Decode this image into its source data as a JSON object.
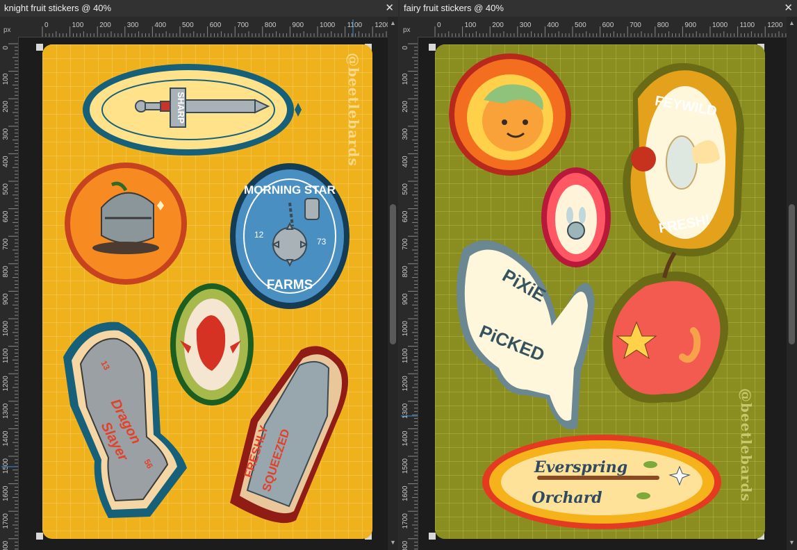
{
  "ruler": {
    "unit": "px",
    "h_ticks": [
      "0",
      "100",
      "200",
      "300",
      "400",
      "500",
      "600",
      "700",
      "800",
      "900",
      "1000",
      "1100",
      "1200"
    ],
    "v_ticks": [
      "0",
      "100",
      "200",
      "300",
      "400",
      "500",
      "600",
      "700",
      "800",
      "900",
      "1000",
      "1100",
      "1200",
      "1300",
      "1400",
      "1500",
      "1600",
      "1700",
      "1800"
    ]
  },
  "left_doc": {
    "tab_title": "knight fruit stickers @ 40%",
    "close_glyph": "✕",
    "bg_color": "#f0b21c",
    "watermark": "@beetlebards",
    "stickers": {
      "sword_label": "SHARP",
      "morning_top": "MORNING STAR",
      "morning_bottom": "FARMS",
      "morning_left_num": "12",
      "morning_right_num": "73",
      "glove_text_1": "Dragon",
      "glove_text_2": "Slayer",
      "glove_num_1": "13",
      "glove_num_2": "56",
      "coffin_text_1": "FRESHLY",
      "coffin_text_2": "SQUEEZED"
    }
  },
  "right_doc": {
    "tab_title": "fairy fruit stickers @ 40%",
    "close_glyph": "✕",
    "bg_color": "#8a8d1f",
    "watermark": "@beetlebards",
    "stickers": {
      "feywild_top": "FEYWILD",
      "feywild_bottom": "FRESH!",
      "pixie_1": "PiXiE",
      "pixie_2": "PiCKED",
      "orchard_1": "Everspring",
      "orchard_2": "Orchard"
    }
  },
  "scroll": {
    "up": "▲",
    "down": "▼"
  }
}
